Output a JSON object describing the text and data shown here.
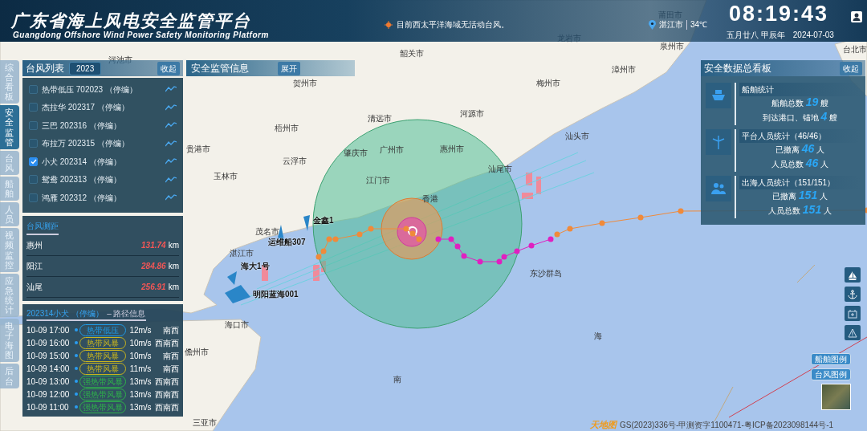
{
  "header": {
    "title": "广东省海上风电安全监管平台",
    "subtitle": "Guangdong Offshore Wind Power Safety Monitoring Platform",
    "notice": "目前西太平洋海域无活动台风。",
    "city": "湛江市",
    "temperature": "34℃",
    "time": "08:19:43",
    "lunar_date": "五月廿八 甲辰年",
    "date": "2024-07-03"
  },
  "side_tabs": [
    {
      "label": "综合看板",
      "selected": false
    },
    {
      "label": "安全监管",
      "selected": true
    },
    {
      "label": "台风",
      "selected": false
    },
    {
      "label": "船舶",
      "selected": false
    },
    {
      "label": "人员",
      "selected": false
    },
    {
      "label": "视频监控",
      "selected": false
    },
    {
      "label": "应急统计",
      "selected": false
    },
    {
      "label": "电子海图",
      "selected": false
    },
    {
      "label": "后台",
      "selected": false
    }
  ],
  "typhoon_list": {
    "title": "台风列表",
    "year": "2023",
    "collapse_button": "收起",
    "items": [
      {
        "label": "热带低压 702023 （停编）",
        "checked": false
      },
      {
        "label": "杰拉华 202317 （停编）",
        "checked": false
      },
      {
        "label": "三巴 202316 （停编）",
        "checked": false
      },
      {
        "label": "布拉万 202315 （停编）",
        "checked": false
      },
      {
        "label": "小犬 202314 （停编）",
        "checked": true
      },
      {
        "label": "鸳鸯 202313 （停编）",
        "checked": false
      },
      {
        "label": "鸿雁 202312 （停编）",
        "checked": false
      }
    ]
  },
  "safety_info": {
    "title": "安全监管信息",
    "expand_button": "展开"
  },
  "distance": {
    "tab": "台风测距",
    "rows": [
      {
        "place": "惠州",
        "distance": "131.74",
        "unit": "km"
      },
      {
        "place": "阳江",
        "distance": "284.86",
        "unit": "km"
      },
      {
        "place": "汕尾",
        "distance": "256.91",
        "unit": "km"
      }
    ]
  },
  "path_info": {
    "title": "202314小犬 （停编）",
    "subtitle": "– 路径信息",
    "rows": [
      {
        "time": "10-09 17:00",
        "level": "热带低压",
        "color": "#1e9be6",
        "speed": "12m/s",
        "direction": "南西"
      },
      {
        "time": "10-09 16:00",
        "level": "热带风暴",
        "color": "#c8b41e",
        "speed": "10m/s",
        "direction": "西南西"
      },
      {
        "time": "10-09 15:00",
        "level": "热带风暴",
        "color": "#c8b41e",
        "speed": "10m/s",
        "direction": "南西"
      },
      {
        "time": "10-09 14:00",
        "level": "热带风暴",
        "color": "#c8b41e",
        "speed": "11m/s",
        "direction": "南西"
      },
      {
        "time": "10-09 13:00",
        "level": "强热带风暴",
        "color": "#2fb34a",
        "speed": "13m/s",
        "direction": "西南西"
      },
      {
        "time": "10-09 12:00",
        "level": "强热带风暴",
        "color": "#2fb34a",
        "speed": "13m/s",
        "direction": "西南西"
      },
      {
        "time": "10-09 11:00",
        "level": "强热带风暴",
        "color": "#2fb34a",
        "speed": "13m/s",
        "direction": "西南西"
      }
    ]
  },
  "dashboard": {
    "title": "安全数据总看板",
    "collapse_button": "收起",
    "sections": [
      {
        "kind": "ship",
        "title": "船舶统计",
        "stats": [
          {
            "label": "船舶总数",
            "value": "19",
            "unit": "艘"
          },
          {
            "label": "到达港口、锚地",
            "value": "4",
            "unit": "艘"
          }
        ]
      },
      {
        "kind": "turbine",
        "title": "平台人员统计（46/46）",
        "stats": [
          {
            "label": "已撤离",
            "value": "46",
            "unit": "人"
          },
          {
            "label": "人员总数",
            "value": "46",
            "unit": "人"
          }
        ]
      },
      {
        "kind": "people",
        "title": "出海人员统计（151/151）",
        "stats": [
          {
            "label": "已撤离",
            "value": "151",
            "unit": "人"
          },
          {
            "label": "人员总数",
            "value": "151",
            "unit": "人"
          }
        ]
      }
    ]
  },
  "map": {
    "cities": [
      "河池市",
      "韶关市",
      "龙岩市",
      "莆田市",
      "泉州市",
      "台北市",
      "贺州市",
      "漳州市",
      "梅州市",
      "清远市",
      "河源市",
      "梧州市",
      "贵港市",
      "肇庆市",
      "广州市",
      "惠州市",
      "云浮市",
      "玉林市",
      "汕头市",
      "江门市",
      "汕尾市",
      "香港",
      "茂名市",
      "湛江市",
      "海口市",
      "儋州市",
      "东沙群岛",
      "三亚市",
      "海",
      "南"
    ],
    "ships": [
      "金鑫1",
      "运维船307",
      "海大1号",
      "明阳蓝海001"
    ]
  },
  "map_tools": [
    {
      "kind": "sailboat"
    },
    {
      "kind": "anchor"
    },
    {
      "kind": "battery"
    },
    {
      "kind": "warning"
    }
  ],
  "legend_buttons": [
    "船舶图例",
    "台风图例"
  ],
  "logo": "天地图",
  "attribution": "GS(2023)336号-甲测资字1100471-粤ICP备2023098144号-1"
}
